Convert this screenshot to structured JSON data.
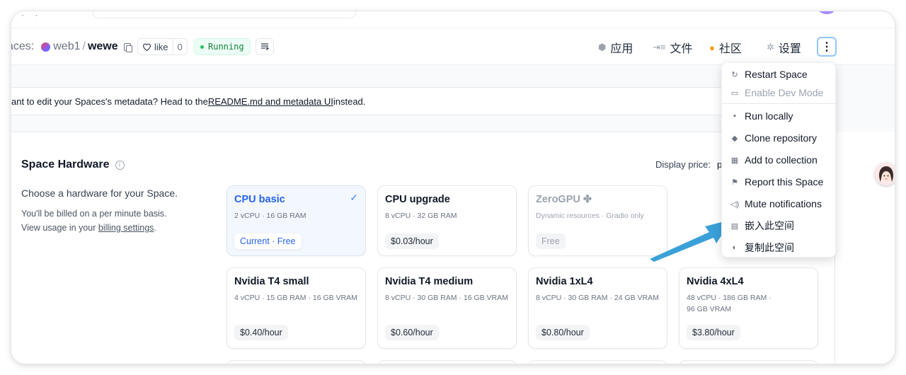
{
  "header": {
    "prefix": "aces:",
    "org": "web1",
    "slash": "/",
    "repo": "wewe",
    "like_label": "like",
    "like_count": "0",
    "status": "Running",
    "nav": [
      {
        "label": "应用",
        "icon": "cube-icon"
      },
      {
        "label": "文件",
        "icon": "files-icon"
      },
      {
        "label": "社区",
        "icon": "community-icon"
      },
      {
        "label": "设置",
        "icon": "gear-icon"
      }
    ],
    "menu_glyph": "⋮"
  },
  "notice": {
    "text_before": "ant to edit your Spaces's metadata? Head to the ",
    "link": "README.md and metadata UI",
    "text_after": " instead."
  },
  "hardware": {
    "title": "Space Hardware",
    "subtitle": "Choose a hardware for your Space.",
    "note1": "You'll be billed on a per minute basis.",
    "note2_before": "View usage in your ",
    "note2_link": "billing settings",
    "note2_after": ".",
    "price_label": "Display price:",
    "price_value": "p",
    "cards": [
      {
        "name": "CPU basic",
        "spec": "2 vCPU · 16 GB RAM",
        "price": "Current · Free",
        "selected": true
      },
      {
        "name": "CPU upgrade",
        "spec": "8 vCPU · 32 GB RAM",
        "price": "$0.03/hour"
      },
      {
        "name": "ZeroGPU ✤",
        "spec": "Dynamic resources · Gradio only",
        "price": "Free",
        "disabled": true
      },
      {
        "name": "Nvidia T4 small",
        "spec": "4 vCPU · 15 GB RAM · 16 GB VRAM",
        "price": "$0.40/hour"
      },
      {
        "name": "Nvidia T4 medium",
        "spec": "8 vCPU · 30 GB RAM · 16 GB VRAM",
        "price": "$0.60/hour"
      },
      {
        "name": "Nvidia 1xL4",
        "spec": "8 vCPU · 30 GB RAM · 24 GB VRAM",
        "price": "$0.80/hour"
      },
      {
        "name": "Nvidia 4xL4",
        "spec": "48 vCPU · 186 GB RAM · 96 GB VRAM",
        "price": "$3.80/hour"
      }
    ]
  },
  "dropdown": {
    "items": [
      {
        "label": "Restart Space",
        "icon": "restart-icon"
      },
      {
        "label": "Enable Dev Mode",
        "icon": "terminal-icon",
        "disabled": true
      },
      {
        "label": "Run locally",
        "icon": "monitor-icon"
      },
      {
        "label": "Clone repository",
        "icon": "git-icon"
      },
      {
        "label": "Add to collection",
        "icon": "collection-icon"
      },
      {
        "label": "Report this Space",
        "icon": "flag-icon"
      },
      {
        "label": "Mute notifications",
        "icon": "speaker-icon"
      },
      {
        "label": "嵌入此空间",
        "icon": "embed-icon"
      },
      {
        "label": "复制此空间",
        "icon": "duplicate-icon"
      }
    ]
  },
  "colors": {
    "accent": "#2563eb",
    "arrow": "#3aa0d8",
    "running": "#15803d"
  }
}
